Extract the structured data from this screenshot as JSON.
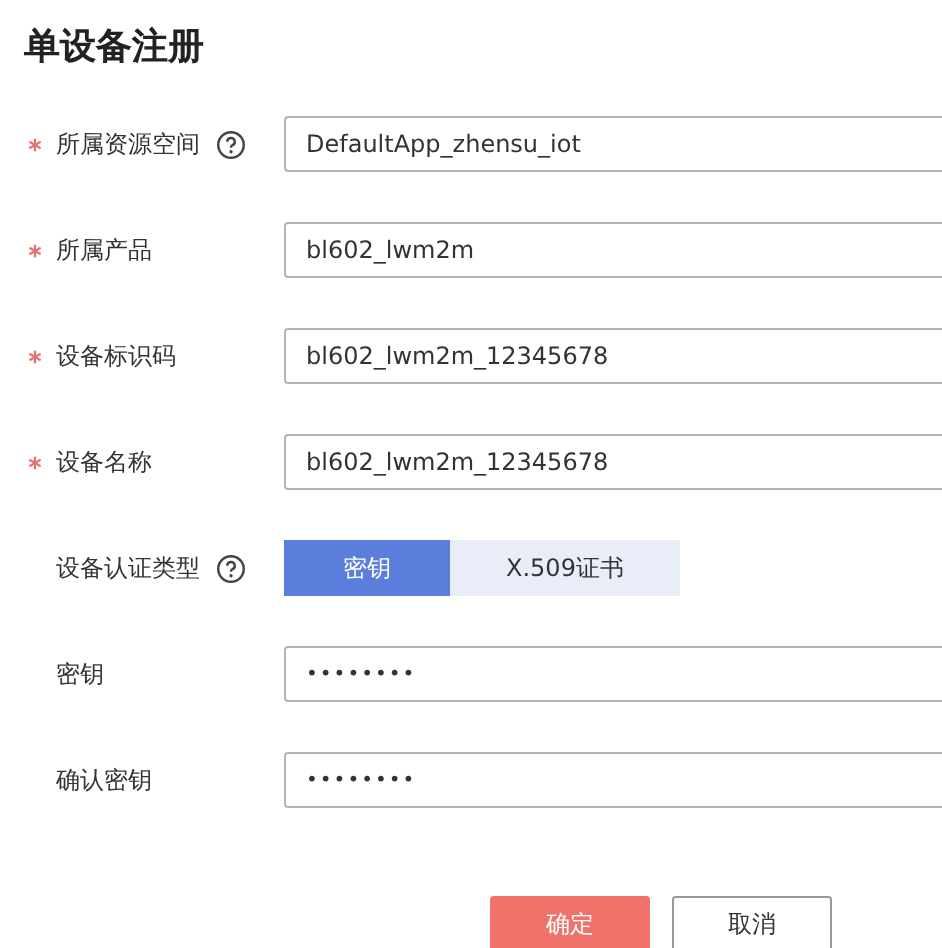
{
  "title": "单设备注册",
  "fields": [
    {
      "kind": "input",
      "label": "所属资源空间",
      "required": true,
      "help": true,
      "value": "DefaultApp_zhensu_iot"
    },
    {
      "kind": "input",
      "label": "所属产品",
      "required": true,
      "help": false,
      "value": "bl602_lwm2m"
    },
    {
      "kind": "input",
      "label": "设备标识码",
      "required": true,
      "help": false,
      "value": "bl602_lwm2m_12345678"
    },
    {
      "kind": "input",
      "label": "设备名称",
      "required": true,
      "help": false,
      "value": "bl602_lwm2m_12345678"
    },
    {
      "kind": "segmented",
      "label": "设备认证类型",
      "required": false,
      "help": true,
      "options": [
        {
          "label": "密钥",
          "selected": true
        },
        {
          "label": "X.509证书",
          "selected": false
        }
      ]
    },
    {
      "kind": "password",
      "label": "密钥",
      "required": false,
      "help": false,
      "value": "••••••••"
    },
    {
      "kind": "password",
      "label": "确认密钥",
      "required": false,
      "help": false,
      "value": "••••••••"
    }
  ],
  "buttons": [
    {
      "label": "确定",
      "kind": "primary"
    },
    {
      "label": "取消",
      "kind": "secondary"
    }
  ]
}
